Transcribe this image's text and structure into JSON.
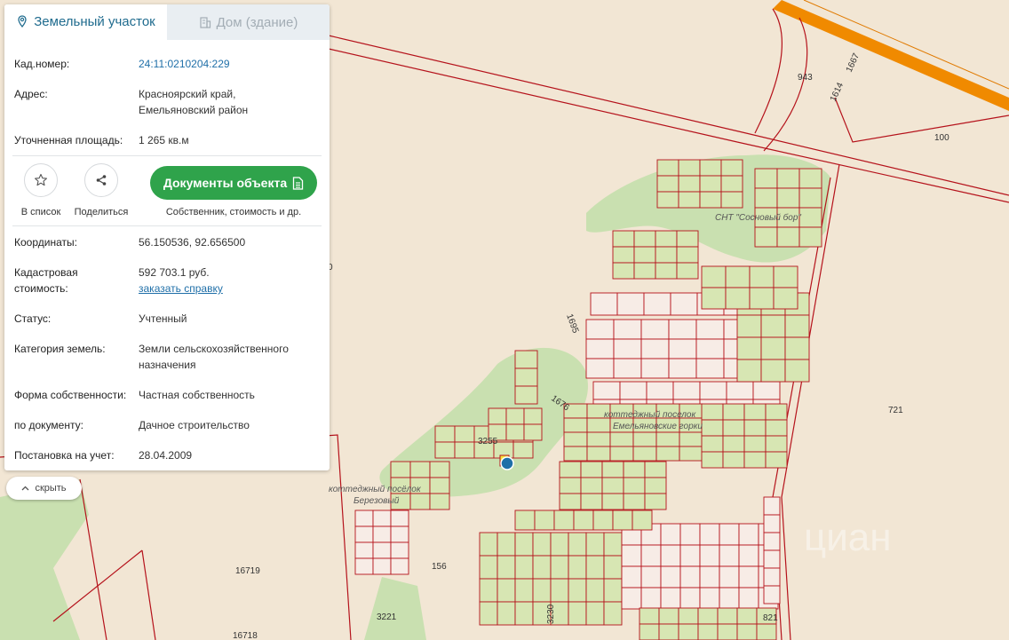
{
  "tabs": {
    "land": "Земельный участок",
    "house": "Дом (здание)"
  },
  "info": {
    "cadnum_label": "Кад.номер:",
    "cadnum_value": "24:11:0210204:229",
    "address_label": "Адрес:",
    "address_line1": "Красноярский край,",
    "address_line2": "Емельяновский район",
    "area_label": "Уточненная площадь:",
    "area_value": "1 265 кв.м"
  },
  "actions": {
    "list_label": "В список",
    "share_label": "Поделиться",
    "docs_button": "Документы объекта",
    "docs_sub": "Собственник, стоимость и др."
  },
  "details": {
    "coords_label": "Координаты:",
    "coords_value": "56.150536, 92.656500",
    "cost_label1": "Кадастровая",
    "cost_label2": "стоимость:",
    "cost_value": "592 703.1 руб.",
    "cost_link": "заказать справку",
    "status_label": "Статус:",
    "status_value": "Учтенный",
    "category_label": "Категория земель:",
    "category_line1": "Земли сельскохозяйственного",
    "category_line2": "назначения",
    "ownership_label": "Форма собственности:",
    "ownership_value": "Частная собственность",
    "bydoc_label": "по документу:",
    "bydoc_value": "Дачное строительство",
    "registered_label": "Постановка на учет:",
    "registered_value": "28.04.2009"
  },
  "hide_button": "скрыть",
  "map_labels": {
    "l943": "943",
    "l1667": "1667",
    "l1614": "1614",
    "l100": "100",
    "l1695": "1695",
    "l1676": "1676",
    "l721": "721",
    "l3255": "3255",
    "l156": "156",
    "l16719": "16719",
    "l16718": "16718",
    "l3221": "3221",
    "l3230": "3230",
    "l821": "821",
    "l0": "0",
    "village1": "коттеджный поселок",
    "village1b": "Емельяновские горки",
    "village2": "коттеджный посёлок",
    "village2b": "Березовый",
    "snt": "СНТ \"Сосновый бор\"",
    "watermark": "циан"
  },
  "colors": {
    "background": "#f2e6d4",
    "forest": "#c9e0b0",
    "parcel_line": "#b5121b",
    "highway": "#f08a00",
    "accent": "#2fa34b",
    "marker": "#1f6fa8"
  }
}
